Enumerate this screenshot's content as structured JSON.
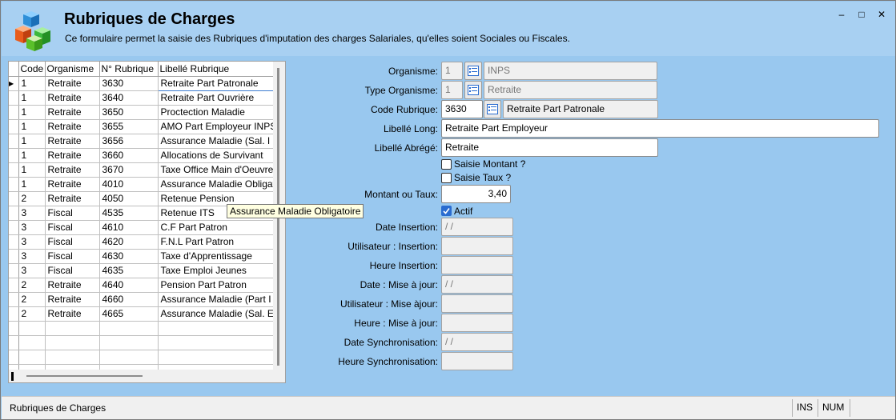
{
  "window": {
    "title": "Rubriques de Charges",
    "subtitle": "Ce formulaire permet la saisie des Rubriques d'imputation des charges Salariales, qu'elles soient Sociales ou Fiscales.",
    "controls": {
      "minimize": "–",
      "maximize": "□",
      "close": "✕"
    }
  },
  "grid": {
    "columns": [
      "Code",
      "Organisme",
      "N° Rubrique",
      "Libellé Rubrique"
    ],
    "selected_row": 0,
    "rows": [
      [
        "1",
        "Retraite",
        "3630",
        "Retraite Part Patronale"
      ],
      [
        "1",
        "Retraite",
        "3640",
        "Retraite Part Ouvrière"
      ],
      [
        "1",
        "Retraite",
        "3650",
        "Proctection Maladie"
      ],
      [
        "1",
        "Retraite",
        "3655",
        "AMO Part Employeur INPS"
      ],
      [
        "1",
        "Retraite",
        "3656",
        "Assurance Maladie (Sal. I"
      ],
      [
        "1",
        "Retraite",
        "3660",
        "Allocations de Survivant"
      ],
      [
        "1",
        "Retraite",
        "3670",
        "Taxe Office Main d'Oeuvre"
      ],
      [
        "1",
        "Retraite",
        "4010",
        "Assurance Maladie Obligat"
      ],
      [
        "2",
        "Retraite",
        "4050",
        "Retenue Pension"
      ],
      [
        "3",
        "Fiscal",
        "4535",
        "Retenue ITS"
      ],
      [
        "3",
        "Fiscal",
        "4610",
        "C.F Part Patron"
      ],
      [
        "3",
        "Fiscal",
        "4620",
        "F.N.L Part Patron"
      ],
      [
        "3",
        "Fiscal",
        "4630",
        "Taxe d'Apprentissage"
      ],
      [
        "3",
        "Fiscal",
        "4635",
        "Taxe Emploi Jeunes"
      ],
      [
        "2",
        "Retraite",
        "4640",
        "Pension Part Patron"
      ],
      [
        "2",
        "Retraite",
        "4660",
        "Assurance Maladie (Part I"
      ],
      [
        "2",
        "Retraite",
        "4665",
        "Assurance Maladie (Sal. E"
      ]
    ],
    "empty_rows": 4,
    "tooltip": "Assurance Maladie Obligatoire"
  },
  "form": {
    "organisme": {
      "label": "Organisme:",
      "code": "1",
      "value": "INPS"
    },
    "type_organisme": {
      "label": "Type Organisme:",
      "code": "1",
      "value": "Retraite"
    },
    "code_rubrique": {
      "label": "Code Rubrique:",
      "code": "3630",
      "value": "Retraite Part Patronale"
    },
    "libelle_long": {
      "label": "Libellé Long:",
      "value": "Retraite Part Employeur"
    },
    "libelle_abrege": {
      "label": "Libellé Abrégé:",
      "value": "Retraite"
    },
    "saisie_montant": {
      "label": "Saisie Montant ?",
      "checked": false
    },
    "saisie_taux": {
      "label": "Saisie Taux ?",
      "checked": false
    },
    "montant_taux": {
      "label": "Montant ou Taux:",
      "value": "3,40"
    },
    "actif": {
      "label": "Actif",
      "checked": true
    },
    "date_insertion": {
      "label": "Date Insertion:",
      "value": " / /"
    },
    "utilisateur_insertion": {
      "label": "Utilisateur : Insertion:",
      "value": ""
    },
    "heure_insertion": {
      "label": "Heure Insertion:",
      "value": ""
    },
    "date_maj": {
      "label": "Date : Mise à jour:",
      "value": " / /"
    },
    "utilisateur_maj": {
      "label": "Utilisateur : Mise àjour:",
      "value": ""
    },
    "heure_maj": {
      "label": "Heure : Mise à jour:",
      "value": ""
    },
    "date_sync": {
      "label": "Date Synchronisation:",
      "value": " / /"
    },
    "heure_sync": {
      "label": "Heure Synchronisation:",
      "value": ""
    }
  },
  "statusbar": {
    "text": "Rubriques de Charges",
    "ins": "INS",
    "num": "NUM"
  },
  "colors": {
    "background": "#99c8ef",
    "header": "#a8d0f2",
    "checkbox_accent": "#2a6cd0"
  }
}
